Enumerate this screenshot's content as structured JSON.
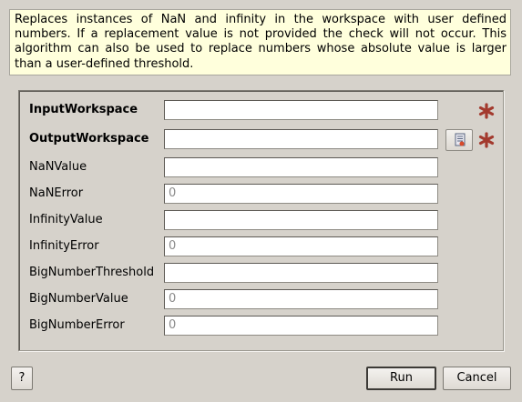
{
  "description": "Replaces instances of NaN and infinity in the workspace with user defined numbers. If a replacement value is not provided the check will not occur. This algorithm can also be used to replace numbers whose absolute value is larger than a user-defined threshold.",
  "fields": [
    {
      "label": "InputWorkspace",
      "value": "",
      "required": true
    },
    {
      "label": "OutputWorkspace",
      "value": "",
      "required": true
    },
    {
      "label": "NaNValue",
      "value": ""
    },
    {
      "label": "NaNError",
      "value": "0"
    },
    {
      "label": "InfinityValue",
      "value": ""
    },
    {
      "label": "InfinityError",
      "value": "0"
    },
    {
      "label": "BigNumberThreshold",
      "value": ""
    },
    {
      "label": "BigNumberValue",
      "value": "0"
    },
    {
      "label": "BigNumberError",
      "value": "0"
    }
  ],
  "icons": {
    "required": "asterisk-icon",
    "browse": "workspace-browse-icon"
  },
  "colors": {
    "required_star": "#a33a2e",
    "description_bg": "#ffffdc"
  },
  "buttons": {
    "help": "?",
    "run": "Run",
    "cancel": "Cancel"
  }
}
